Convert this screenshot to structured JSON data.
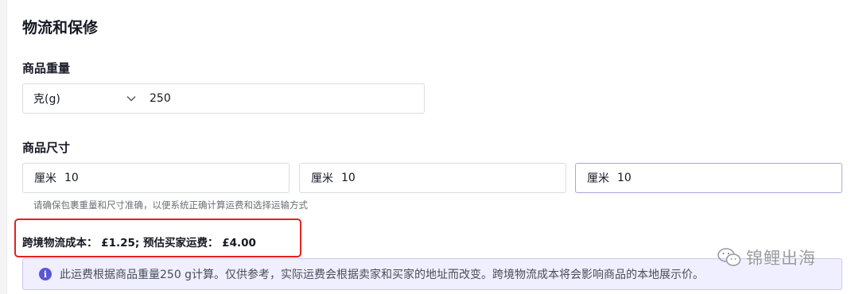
{
  "section": {
    "title": "物流和保修"
  },
  "weight": {
    "label": "商品重量",
    "unit": "克(g)",
    "value": "250"
  },
  "dimensions": {
    "label": "商品尺寸",
    "fields": [
      {
        "unit": "厘米",
        "value": "10"
      },
      {
        "unit": "厘米",
        "value": "10"
      },
      {
        "unit": "厘米",
        "value": "10"
      }
    ],
    "hint": "请确保包裹重量和尺寸准确，以便系统正确计算运费和选择运输方式"
  },
  "costs": {
    "text": "跨境物流成本：  £1.25; 预估买家运费：  £4.00"
  },
  "notice": {
    "icon": "info-icon",
    "text": "此运费根据商品重量250 g计算。仅供参考，实际运费会根据卖家和买家的地址而改变。跨境物流成本将会影响商品的本地展示价。"
  },
  "watermark": {
    "text": "锦鲤出海",
    "icon": "wechat-icon"
  },
  "colors": {
    "highlight": "#e2231a",
    "accent": "#5a55d4",
    "notice_bg": "#efefff"
  }
}
